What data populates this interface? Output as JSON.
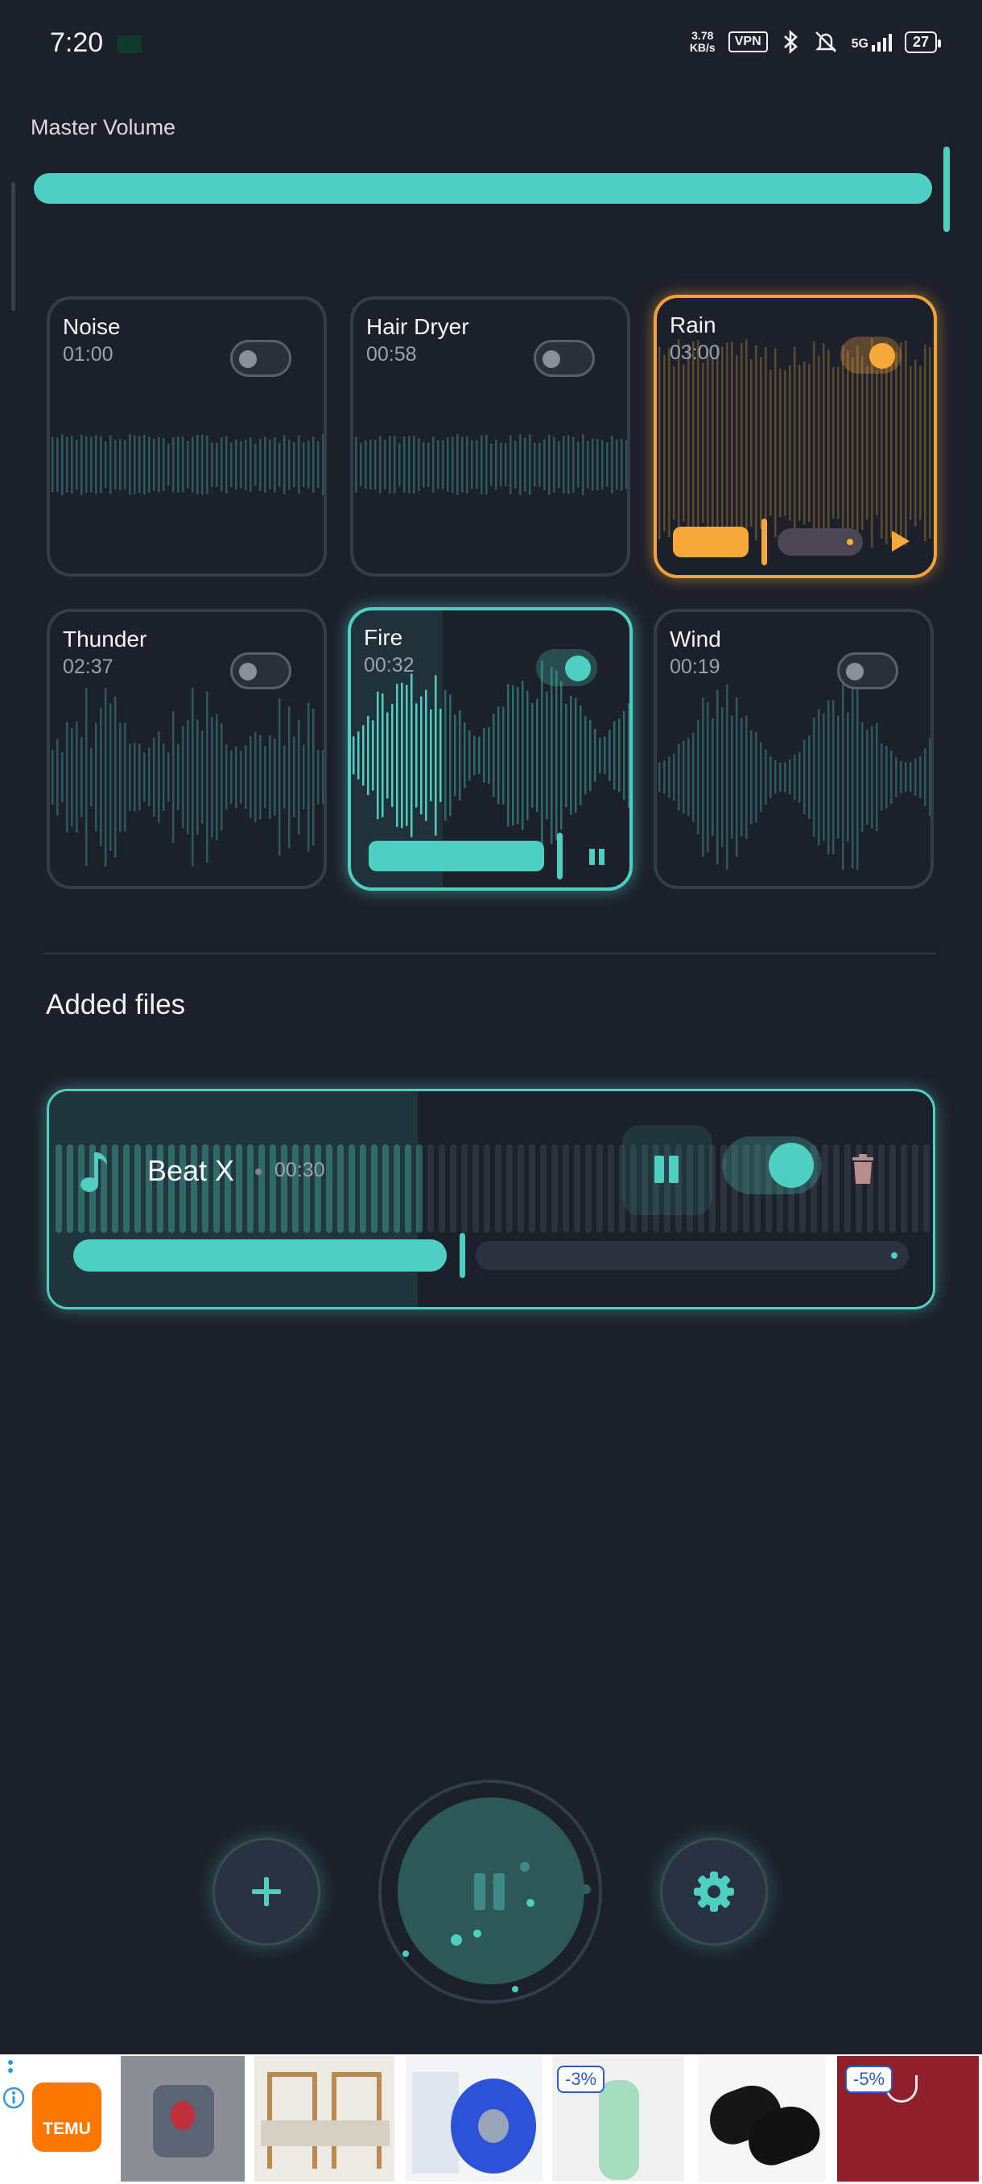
{
  "status_bar": {
    "time": "7:20",
    "net_speed_value": "3.78",
    "net_speed_unit": "KB/s",
    "vpn_label": "VPN",
    "network_label": "5G",
    "battery_level": "27"
  },
  "master_volume": {
    "label": "Master Volume",
    "level_fraction": 1.0
  },
  "sounds": [
    {
      "name": "Noise",
      "time": "01:00",
      "enabled": false
    },
    {
      "name": "Hair Dryer",
      "time": "00:58",
      "enabled": false
    },
    {
      "name": "Rain",
      "time": "03:00",
      "enabled": true,
      "playback": "paused"
    },
    {
      "name": "Thunder",
      "time": "02:37",
      "enabled": false
    },
    {
      "name": "Fire",
      "time": "00:32",
      "enabled": true,
      "playback": "playing"
    },
    {
      "name": "Wind",
      "time": "00:19",
      "enabled": false
    }
  ],
  "added_files": {
    "title": "Added files",
    "items": [
      {
        "name": "Beat X",
        "time": "00:30",
        "enabled": true,
        "playback": "playing"
      }
    ]
  },
  "colors": {
    "background": "#1c202b",
    "accent": "#4ecfc1",
    "rain_accent": "#f2a23c",
    "card_border": "#363c48"
  },
  "icons": {
    "add": "plus-icon",
    "main": "pause-icon",
    "settings": "gear-icon",
    "file": "music-note-icon",
    "delete": "trash-icon",
    "play": "play-icon"
  },
  "ad_banner": {
    "brand": "TEMU",
    "discounts": [
      "-3%",
      "-5%"
    ]
  }
}
